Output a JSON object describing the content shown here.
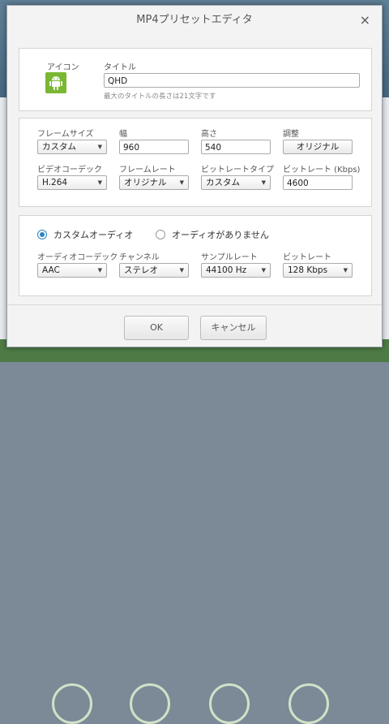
{
  "dialog": {
    "title": "MP4プリセットエディタ",
    "close_glyph": "×"
  },
  "general": {
    "icon_label": "アイコン",
    "icon_name": "android-icon",
    "title_label": "タイトル",
    "title_value": "QHD",
    "title_hint": "最大のタイトルの長さは21文字です"
  },
  "video": {
    "frame_size_label": "フレームサイズ",
    "frame_size_value": "カスタム",
    "width_label": "幅",
    "width_value": "960",
    "height_label": "高さ",
    "height_value": "540",
    "adjust_label": "調整",
    "adjust_button": "オリジナル",
    "codec_label": "ビデオコーデック",
    "codec_value": "H.264",
    "framerate_label": "フレームレート",
    "framerate_value": "オリジナル",
    "bitrate_type_label": "ビットレートタイプ",
    "bitrate_type_value": "カスタム",
    "bitrate_label": "ビットレート (Kbps)",
    "bitrate_value": "4600"
  },
  "audio": {
    "custom_audio_label": "カスタムオーディオ",
    "no_audio_label": "オーディオがありません",
    "selected": "custom",
    "codec_label": "オーディオコーデック",
    "codec_value": "AAC",
    "channel_label": "チャンネル",
    "channel_value": "ステレオ",
    "sample_rate_label": "サンプルレート",
    "sample_rate_value": "44100 Hz",
    "bitrate_label": "ビットレート",
    "bitrate_value": "128 Kbps"
  },
  "buttons": {
    "ok": "OK",
    "cancel": "キャンセル"
  },
  "colors": {
    "accent": "#2b84c6",
    "android_green": "#7ab733"
  }
}
